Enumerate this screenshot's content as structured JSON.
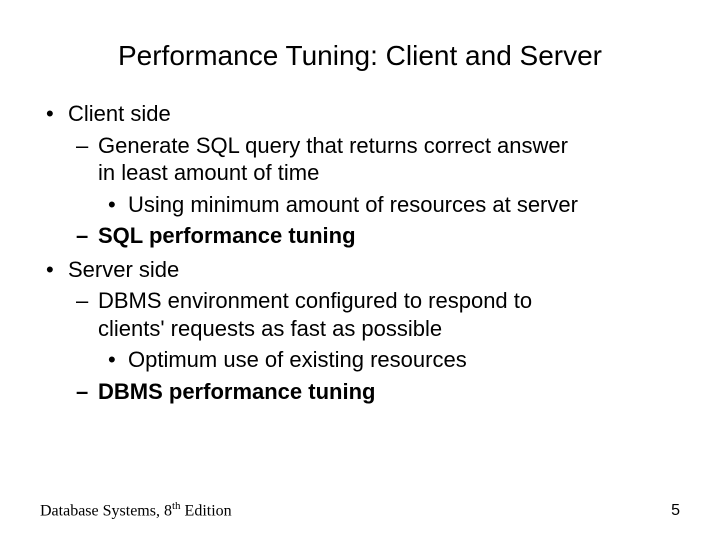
{
  "title": "Performance Tuning: Client and Server",
  "b1": "Client side",
  "b1_1a": "Generate SQL query that returns correct answer",
  "b1_1b": "in least amount of time",
  "b1_1_1": "Using minimum amount of resources at server",
  "b1_2": "SQL performance tuning",
  "b2": "Server side",
  "b2_1a": "DBMS environment configured to respond to",
  "b2_1b": "clients' requests as fast as possible",
  "b2_1_1": "Optimum use of existing resources",
  "b2_2": "DBMS performance tuning",
  "footer_left_a": "Database Systems, 8",
  "footer_left_b": "th",
  "footer_left_c": " Edition",
  "page_number": "5"
}
